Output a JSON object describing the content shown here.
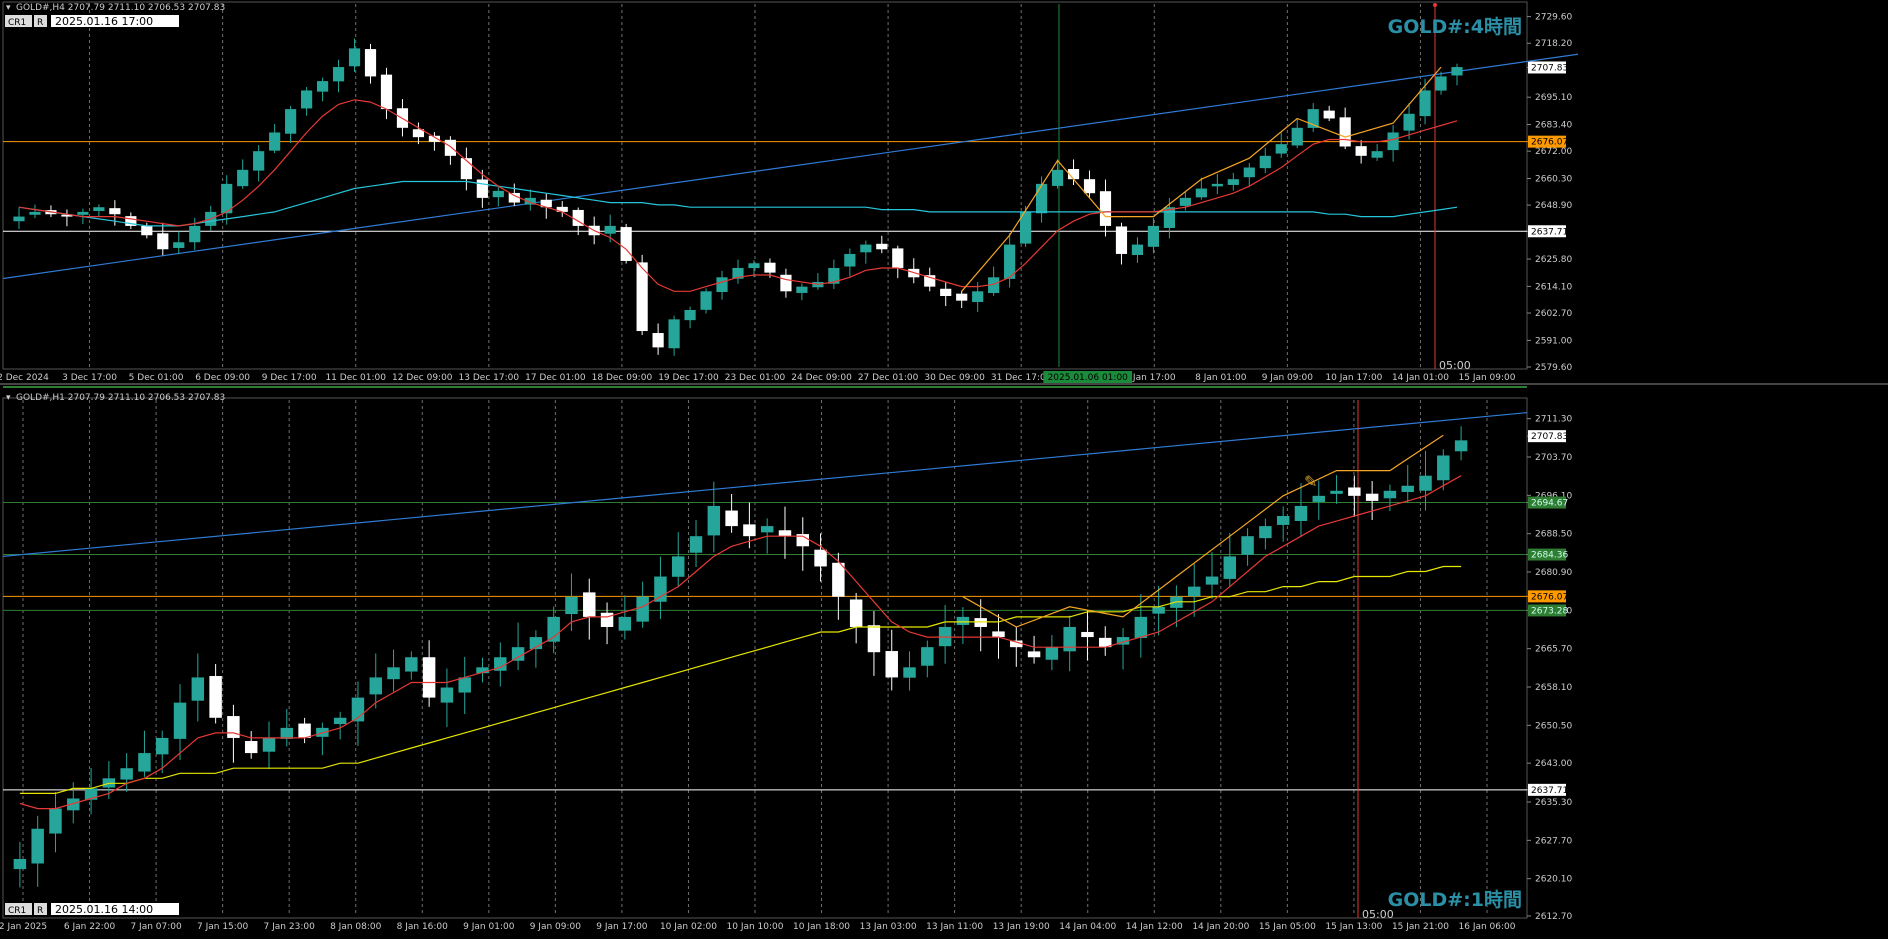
{
  "colors": {
    "background": "#000000",
    "up_candle": "#26a69a",
    "down_candle": "#ffffff",
    "ma_fast": "#e53935",
    "ma_slow_h4": "#26c6da",
    "ma_slow_h1": "#e6e600",
    "zigzag": "#f5a623",
    "trendline": "#2f7bd6",
    "hline_orange": "#ff9900",
    "hline_white": "#ffffff",
    "hline_green": "#2e7d32",
    "vline_red": "#e53935",
    "vline_green": "#1b8a3a",
    "watermark": "#2b8fa6"
  },
  "panels": [
    {
      "id": "h4",
      "header": "GOLD#,H4  2707.79 2711.10 2706.53 2707.83",
      "badges": [
        "CR1",
        "R"
      ],
      "date_box": "2025.01.16 17:00",
      "watermark": "GOLD#:4時間",
      "vline_label": "05:00",
      "y_ticks": [
        "2729.60",
        "2718.20",
        "2707.83",
        "2695.10",
        "2683.40",
        "2676.07",
        "2672.00",
        "2660.30",
        "2648.90",
        "2637.71",
        "2625.80",
        "2614.10",
        "2602.70",
        "2591.00",
        "2579.60"
      ],
      "price_tags": [
        {
          "text": "2707.83",
          "kind": "current"
        },
        {
          "text": "2676.07",
          "kind": "orange"
        },
        {
          "text": "2637.71",
          "kind": "white"
        }
      ],
      "x_ticks": [
        "2 Dec 2024",
        "3 Dec 17:00",
        "5 Dec 01:00",
        "6 Dec 09:00",
        "9 Dec 17:00",
        "11 Dec 01:00",
        "12 Dec 09:00",
        "13 Dec 17:00",
        "17 Dec 01:00",
        "18 Dec 09:00",
        "19 Dec 17:00",
        "23 Dec 01:00",
        "24 Dec 09:00",
        "27 Dec 01:00",
        "30 Dec 09:00",
        "31 Dec 17:00",
        "2025.01.06 01:00",
        "Jan 17:00",
        "8 Jan 01:00",
        "9 Jan 09:00",
        "10 Jan 17:00",
        "14 Jan 01:00",
        "15 Jan 09:00"
      ]
    },
    {
      "id": "h1",
      "header": "GOLD#,H1  2707.79 2711.10 2706.53 2707.83",
      "badges": [
        "CR1",
        "R"
      ],
      "date_box": "2025.01.16 14:00",
      "watermark": "GOLD#:1時間",
      "vline_label": "05:00",
      "y_ticks": [
        "2711.30",
        "2707.83",
        "2703.70",
        "2696.10",
        "2694.67",
        "2688.50",
        "2684.36",
        "2680.90",
        "2676.07",
        "2673.30",
        "2665.70",
        "2658.10",
        "2650.50",
        "2643.00",
        "2637.71",
        "2635.30",
        "2627.70",
        "2620.10",
        "2612.70"
      ],
      "price_tags": [
        {
          "text": "2707.83",
          "kind": "current"
        },
        {
          "text": "2694.67",
          "kind": "green"
        },
        {
          "text": "2684.36",
          "kind": "green"
        },
        {
          "text": "2676.07",
          "kind": "orange"
        },
        {
          "text": "2673.28",
          "kind": "green"
        },
        {
          "text": "2637.71",
          "kind": "white"
        }
      ],
      "x_ticks": [
        "2 Jan 2025",
        "6 Jan 22:00",
        "7 Jan 07:00",
        "7 Jan 15:00",
        "7 Jan 23:00",
        "8 Jan 08:00",
        "8 Jan 16:00",
        "9 Jan 01:00",
        "9 Jan 09:00",
        "9 Jan 17:00",
        "10 Jan 02:00",
        "10 Jan 10:00",
        "10 Jan 18:00",
        "13 Jan 03:00",
        "13 Jan 11:00",
        "13 Jan 19:00",
        "14 Jan 04:00",
        "14 Jan 12:00",
        "14 Jan 20:00",
        "15 Jan 05:00",
        "15 Jan 13:00",
        "15 Jan 21:00",
        "16 Jan 06:00"
      ]
    }
  ],
  "chart_data": [
    {
      "type": "candlestick",
      "symbol": "GOLD#",
      "timeframe": "H4",
      "title": "GOLD#:4時間",
      "ohlc_last": {
        "open": 2707.79,
        "high": 2711.1,
        "low": 2706.53,
        "close": 2707.83
      },
      "ylim": [
        2579.6,
        2735
      ],
      "levels": {
        "orange": 2676.07,
        "white": 2637.71
      },
      "trendline": {
        "start": [
          0,
          2617.5
        ],
        "end": [
          220,
          2713.5
        ]
      },
      "series": [
        {
          "name": "close",
          "values": [
            2644,
            2646,
            2645,
            2644,
            2646,
            2648,
            2645,
            2640,
            2636,
            2630,
            2633,
            2640,
            2646,
            2658,
            2664,
            2672,
            2680,
            2690,
            2698,
            2702,
            2708,
            2716,
            2704,
            2690,
            2682,
            2678,
            2676,
            2670,
            2660,
            2652,
            2655,
            2650,
            2652,
            2648,
            2646,
            2640,
            2636,
            2640,
            2625,
            2595,
            2588,
            2600,
            2604,
            2612,
            2618,
            2622,
            2624,
            2620,
            2612,
            2614,
            2616,
            2622,
            2628,
            2632,
            2630,
            2622,
            2618,
            2614,
            2610,
            2608,
            2612,
            2618,
            2632,
            2646,
            2658,
            2664,
            2660,
            2654,
            2640,
            2628,
            2632,
            2640,
            2648,
            2652,
            2656,
            2658,
            2660,
            2665,
            2670,
            2675,
            2682,
            2690,
            2686,
            2674,
            2670,
            2672,
            2680,
            2688,
            2698,
            2704,
            2708
          ]
        },
        {
          "name": "ma_fast",
          "values": [
            2648,
            2647,
            2646,
            2645,
            2644,
            2644,
            2644,
            2643,
            2642,
            2641,
            2640,
            2641,
            2643,
            2646,
            2651,
            2657,
            2664,
            2672,
            2680,
            2687,
            2692,
            2694,
            2693,
            2690,
            2686,
            2682,
            2678,
            2674,
            2668,
            2662,
            2657,
            2653,
            2650,
            2648,
            2646,
            2642,
            2638,
            2635,
            2630,
            2622,
            2615,
            2612,
            2612,
            2614,
            2616,
            2618,
            2619,
            2619,
            2617,
            2616,
            2615,
            2616,
            2618,
            2621,
            2622,
            2622,
            2620,
            2618,
            2616,
            2614,
            2614,
            2615,
            2618,
            2624,
            2631,
            2638,
            2642,
            2645,
            2646,
            2646,
            2646,
            2646,
            2647,
            2648,
            2650,
            2652,
            2654,
            2657,
            2661,
            2665,
            2670,
            2675,
            2677,
            2677,
            2676,
            2676,
            2677,
            2679,
            2681,
            2683,
            2685
          ]
        },
        {
          "name": "ma_slow",
          "values": [
            2648,
            2647,
            2646,
            2645,
            2644,
            2643,
            2642,
            2641,
            2640,
            2640,
            2640,
            2641,
            2642,
            2643,
            2644,
            2645,
            2646,
            2648,
            2650,
            2652,
            2654,
            2656,
            2657,
            2658,
            2659,
            2659,
            2659,
            2659,
            2659,
            2658,
            2657,
            2656,
            2655,
            2654,
            2653,
            2652,
            2651,
            2650,
            2650,
            2650,
            2649,
            2649,
            2648,
            2648,
            2648,
            2648,
            2648,
            2648,
            2648,
            2648,
            2648,
            2648,
            2648,
            2648,
            2647,
            2647,
            2647,
            2646,
            2646,
            2646,
            2646,
            2646,
            2646,
            2646,
            2646,
            2646,
            2646,
            2646,
            2646,
            2646,
            2646,
            2646,
            2646,
            2646,
            2646,
            2646,
            2646,
            2646,
            2646,
            2646,
            2646,
            2646,
            2645,
            2645,
            2644,
            2644,
            2644,
            2645,
            2646,
            2647,
            2648
          ]
        }
      ]
    },
    {
      "type": "candlestick",
      "symbol": "GOLD#",
      "timeframe": "H1",
      "title": "GOLD#:1時間",
      "ohlc_last": {
        "open": 2707.79,
        "high": 2711.1,
        "low": 2706.53,
        "close": 2707.83
      },
      "ylim": [
        2612.7,
        2715
      ],
      "levels": {
        "orange": 2676.07,
        "white": 2637.71,
        "green": [
          2694.67,
          2684.36,
          2673.28
        ]
      },
      "trendline": {
        "start": [
          0,
          2684
        ],
        "end": [
          220,
          2712.5
        ]
      },
      "series": [
        {
          "name": "close",
          "values": [
            2624,
            2630,
            2634,
            2636,
            2638,
            2640,
            2642,
            2645,
            2648,
            2655,
            2660,
            2652,
            2648,
            2645,
            2648,
            2650,
            2648,
            2650,
            2652,
            2656,
            2660,
            2662,
            2664,
            2656,
            2658,
            2660,
            2662,
            2664,
            2666,
            2668,
            2672,
            2676,
            2672,
            2670,
            2672,
            2676,
            2680,
            2684,
            2688,
            2694,
            2690,
            2688,
            2690,
            2688,
            2686,
            2682,
            2676,
            2670,
            2665,
            2660,
            2662,
            2666,
            2670,
            2672,
            2670,
            2668,
            2666,
            2664,
            2666,
            2670,
            2668,
            2666,
            2668,
            2672,
            2674,
            2676,
            2678,
            2680,
            2684,
            2688,
            2690,
            2692,
            2694,
            2696,
            2697,
            2696,
            2695,
            2697,
            2698,
            2700,
            2704,
            2707
          ]
        },
        {
          "name": "ma_fast",
          "values": [
            2635,
            2634,
            2634,
            2635,
            2636,
            2637,
            2639,
            2640,
            2642,
            2645,
            2648,
            2649,
            2649,
            2648,
            2648,
            2648,
            2648,
            2649,
            2650,
            2652,
            2655,
            2657,
            2659,
            2659,
            2659,
            2660,
            2661,
            2662,
            2664,
            2666,
            2668,
            2671,
            2672,
            2672,
            2673,
            2674,
            2676,
            2678,
            2681,
            2684,
            2686,
            2687,
            2688,
            2688,
            2688,
            2686,
            2683,
            2679,
            2675,
            2671,
            2669,
            2668,
            2668,
            2668,
            2668,
            2668,
            2667,
            2666,
            2666,
            2666,
            2666,
            2666,
            2667,
            2668,
            2669,
            2671,
            2673,
            2675,
            2678,
            2681,
            2684,
            2686,
            2688,
            2690,
            2691,
            2692,
            2693,
            2694,
            2695,
            2696,
            2698,
            2700
          ]
        },
        {
          "name": "ma_slow",
          "values": [
            2637,
            2637,
            2637,
            2638,
            2638,
            2639,
            2639,
            2640,
            2640,
            2641,
            2641,
            2641,
            2642,
            2642,
            2642,
            2642,
            2642,
            2642,
            2643,
            2643,
            2644,
            2645,
            2646,
            2647,
            2648,
            2649,
            2650,
            2651,
            2652,
            2653,
            2654,
            2655,
            2656,
            2657,
            2658,
            2659,
            2660,
            2661,
            2662,
            2663,
            2664,
            2665,
            2666,
            2667,
            2668,
            2669,
            2669,
            2670,
            2670,
            2670,
            2670,
            2670,
            2671,
            2671,
            2671,
            2671,
            2672,
            2672,
            2672,
            2672,
            2673,
            2673,
            2673,
            2674,
            2674,
            2675,
            2675,
            2676,
            2676,
            2677,
            2677,
            2678,
            2678,
            2679,
            2679,
            2680,
            2680,
            2680,
            2681,
            2681,
            2682,
            2682
          ]
        }
      ]
    }
  ]
}
